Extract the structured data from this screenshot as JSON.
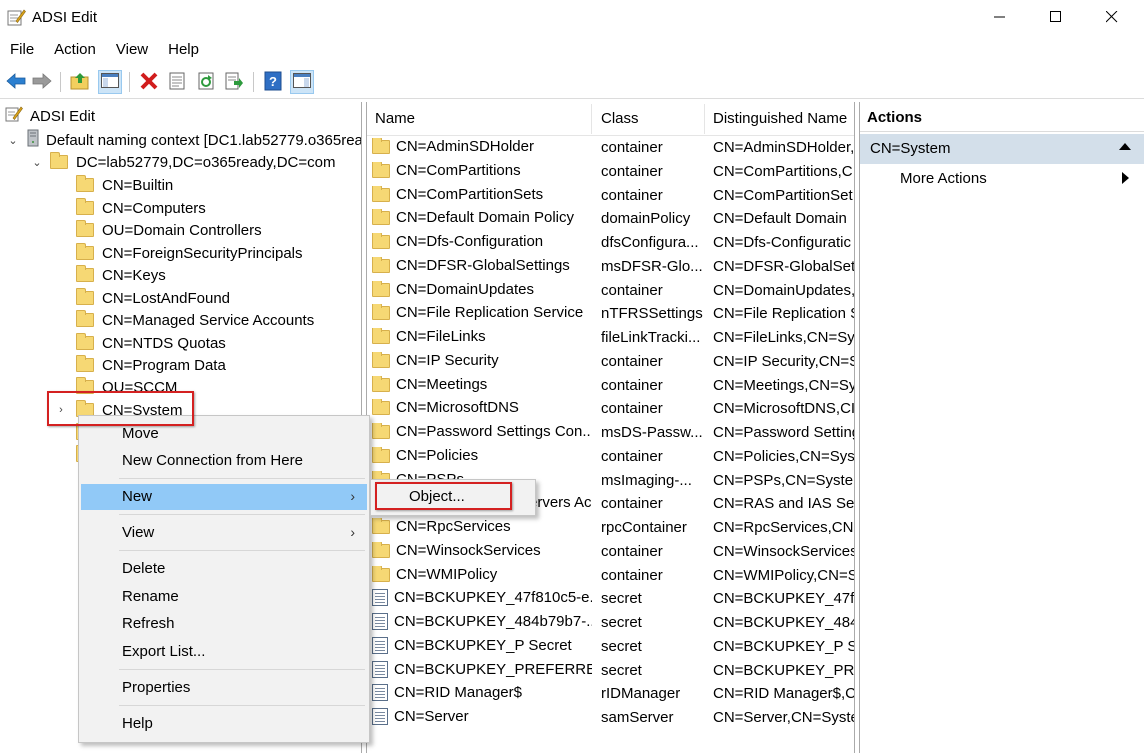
{
  "window": {
    "title": "ADSI Edit",
    "controls": [
      "minimize",
      "maximize",
      "close"
    ]
  },
  "menubar": [
    "File",
    "Action",
    "View",
    "Help"
  ],
  "toolbar": {
    "buttons": [
      "back-icon",
      "forward-icon",
      "up-folder-icon",
      "show-hide-console-tree-icon",
      "delete-icon",
      "properties-icon",
      "refresh-icon",
      "export-list-icon",
      "help-icon",
      "show-hide-action-pane-icon"
    ]
  },
  "tree": {
    "root": "ADSI Edit",
    "context": "Default naming context [DC1.lab52779.o365rea",
    "domain": "DC=lab52779,DC=o365ready,DC=com",
    "children": [
      "CN=Builtin",
      "CN=Computers",
      "OU=Domain Controllers",
      "CN=ForeignSecurityPrincipals",
      "CN=Keys",
      "CN=LostAndFound",
      "CN=Managed Service Accounts",
      "CN=NTDS Quotas",
      "CN=Program Data",
      "OU=SCCM",
      "CN=System"
    ]
  },
  "list": {
    "columns": [
      "Name",
      "Class",
      "Distinguished Name"
    ],
    "rows": [
      {
        "name": "CN=AdminSDHolder",
        "class": "container",
        "dn": "CN=AdminSDHolder,",
        "icon": "folder"
      },
      {
        "name": "CN=ComPartitions",
        "class": "container",
        "dn": "CN=ComPartitions,C",
        "icon": "folder"
      },
      {
        "name": "CN=ComPartitionSets",
        "class": "container",
        "dn": "CN=ComPartitionSet",
        "icon": "folder"
      },
      {
        "name": "CN=Default Domain Policy",
        "class": "domainPolicy",
        "dn": "CN=Default Domain",
        "icon": "folder"
      },
      {
        "name": "CN=Dfs-Configuration",
        "class": "dfsConfigura...",
        "dn": "CN=Dfs-Configuratic",
        "icon": "folder"
      },
      {
        "name": "CN=DFSR-GlobalSettings",
        "class": "msDFSR-Glo...",
        "dn": "CN=DFSR-GlobalSett",
        "icon": "folder"
      },
      {
        "name": "CN=DomainUpdates",
        "class": "container",
        "dn": "CN=DomainUpdates,",
        "icon": "folder"
      },
      {
        "name": "CN=File Replication Service",
        "class": "nTFRSSettings",
        "dn": "CN=File Replication S",
        "icon": "folder"
      },
      {
        "name": "CN=FileLinks",
        "class": "fileLinkTracki...",
        "dn": "CN=FileLinks,CN=Sys",
        "icon": "folder"
      },
      {
        "name": "CN=IP Security",
        "class": "container",
        "dn": "CN=IP Security,CN=S",
        "icon": "folder"
      },
      {
        "name": "CN=Meetings",
        "class": "container",
        "dn": "CN=Meetings,CN=Sy",
        "icon": "folder"
      },
      {
        "name": "CN=MicrosoftDNS",
        "class": "container",
        "dn": "CN=MicrosoftDNS,CI",
        "icon": "folder"
      },
      {
        "name": "CN=Password Settings Con...",
        "class": "msDS-Passw...",
        "dn": "CN=Password Setting",
        "icon": "folder"
      },
      {
        "name": "CN=Policies",
        "class": "container",
        "dn": "CN=Policies,CN=Syst",
        "icon": "folder"
      },
      {
        "name": "CN=PSPs",
        "class": "msImaging-...",
        "dn": "CN=PSPs,CN=Systen",
        "icon": "folder"
      },
      {
        "name": "CN=RAS and IAS Servers Ac...",
        "class": "container",
        "dn": "CN=RAS and IAS Serv",
        "icon": "folder"
      },
      {
        "name": "CN=RpcServices",
        "class": "rpcContainer",
        "dn": "CN=RpcServices,CN=",
        "icon": "folder"
      },
      {
        "name": "CN=WinsockServices",
        "class": "container",
        "dn": "CN=WinsockServices",
        "icon": "folder"
      },
      {
        "name": "CN=WMIPolicy",
        "class": "container",
        "dn": "CN=WMIPolicy,CN=S",
        "icon": "folder"
      },
      {
        "name": "CN=BCKUPKEY_47f810c5-e...",
        "class": "secret",
        "dn": "CN=BCKUPKEY_47f81",
        "icon": "doc"
      },
      {
        "name": "CN=BCKUPKEY_484b79b7-...",
        "class": "secret",
        "dn": "CN=BCKUPKEY_484b",
        "icon": "doc"
      },
      {
        "name": "CN=BCKUPKEY_P Secret",
        "class": "secret",
        "dn": "CN=BCKUPKEY_P Sec",
        "icon": "doc"
      },
      {
        "name": "CN=BCKUPKEY_PREFERRED...",
        "class": "secret",
        "dn": "CN=BCKUPKEY_PREF",
        "icon": "doc"
      },
      {
        "name": "CN=RID Manager$",
        "class": "rIDManager",
        "dn": "CN=RID Manager$,CI",
        "icon": "doc"
      },
      {
        "name": "CN=Server",
        "class": "samServer",
        "dn": "CN=Server,CN=Syste",
        "icon": "doc"
      }
    ]
  },
  "actions": {
    "title": "Actions",
    "section": "CN=System",
    "more": "More Actions"
  },
  "context_menu": {
    "items": [
      "Move",
      "New Connection from Here",
      "New",
      "View",
      "Delete",
      "Rename",
      "Refresh",
      "Export List...",
      "Properties",
      "Help"
    ],
    "highlighted": "New"
  },
  "submenu": {
    "items": [
      "Object..."
    ]
  },
  "colors": {
    "menu_highlight": "#91c9f7",
    "annotation_red": "#d42121",
    "actions_section_bg": "#d3dfea"
  }
}
